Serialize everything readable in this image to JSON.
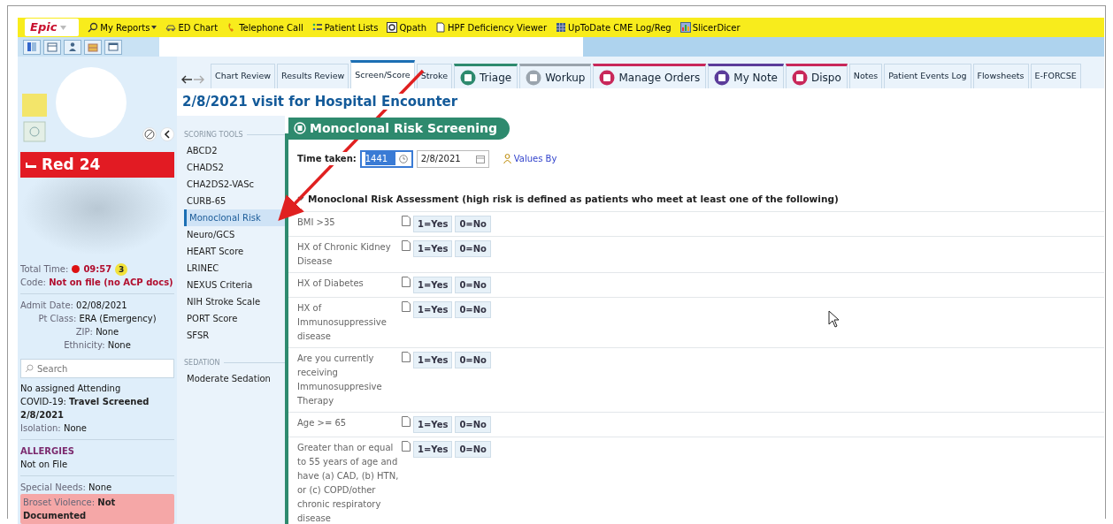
{
  "toolbar": {
    "menu": "Epic",
    "items": [
      {
        "label": "My Reports",
        "dropdown": true
      },
      {
        "label": "ED Chart",
        "dropdown": false
      },
      {
        "label": "Telephone Call",
        "dropdown": false
      },
      {
        "label": "Patient Lists",
        "dropdown": false
      },
      {
        "label": "Qpath",
        "dropdown": false
      },
      {
        "label": "HPF Deficiency Viewer",
        "dropdown": false
      },
      {
        "label": "UpToDate CME Log/Reg",
        "dropdown": false
      },
      {
        "label": "SlicerDicer",
        "dropdown": false
      }
    ]
  },
  "sidebar": {
    "unit": "Red 24",
    "total_time": {
      "label": "Total Time:",
      "value": "09:57",
      "badge": "3"
    },
    "code": {
      "label": "Code:",
      "value": "Not on file (no ACP docs)"
    },
    "details": [
      {
        "label": "Admit Date:",
        "value": "02/08/2021"
      },
      {
        "label": "Pt Class:",
        "value": "ERA (Emergency)"
      },
      {
        "label": "ZIP:",
        "value": "None"
      },
      {
        "label": "Ethnicity:",
        "value": "None"
      }
    ],
    "search": {
      "placeholder": "Search"
    },
    "attending": "No assigned Attending",
    "covid": {
      "label": "COVID-19:",
      "value": "Travel Screened 2/8/2021"
    },
    "isolation": {
      "label": "Isolation:",
      "value": "None"
    },
    "allergies": {
      "heading": "ALLERGIES",
      "value": "Not on File"
    },
    "special_needs": {
      "label": "Special Needs:",
      "value": "None"
    },
    "broset": {
      "label": "Broset Violence:",
      "value": "Not Documented"
    }
  },
  "tabs": [
    {
      "label": "Chart Review",
      "selected": false,
      "kind": "plain"
    },
    {
      "label": "Results Review",
      "selected": false,
      "kind": "plain"
    },
    {
      "label": "Screen/Score",
      "selected": true,
      "kind": "plain"
    },
    {
      "label": "Stroke",
      "selected": false,
      "kind": "plain"
    },
    {
      "label": "Triage",
      "selected": false,
      "kind": "activity",
      "color": "#2e8a6e"
    },
    {
      "label": "Workup",
      "selected": false,
      "kind": "activity",
      "color": "#9aa4ad"
    },
    {
      "label": "Manage Orders",
      "selected": false,
      "kind": "activity",
      "color": "#c8285a"
    },
    {
      "label": "My Note",
      "selected": false,
      "kind": "activity",
      "color": "#5b3c9a"
    },
    {
      "label": "Dispo",
      "selected": false,
      "kind": "activity",
      "color": "#c8285a"
    },
    {
      "label": "Notes",
      "selected": false,
      "kind": "plain"
    },
    {
      "label": "Patient Events Log",
      "selected": false,
      "kind": "plain"
    },
    {
      "label": "Flowsheets",
      "selected": false,
      "kind": "plain"
    },
    {
      "label": "E-FORCSE",
      "selected": false,
      "kind": "plain"
    }
  ],
  "encounter_title": "2/8/2021 visit for Hospital Encounter",
  "scoring_tools": {
    "heading": "SCORING TOOLS",
    "items": [
      {
        "label": "ABCD2",
        "selected": false
      },
      {
        "label": "CHADS2",
        "selected": false
      },
      {
        "label": "CHA2DS2-VASc",
        "selected": false
      },
      {
        "label": "CURB-65",
        "selected": false
      },
      {
        "label": "Monoclonal Risk",
        "selected": true
      },
      {
        "label": "Neuro/GCS",
        "selected": false
      },
      {
        "label": "HEART Score",
        "selected": false
      },
      {
        "label": "LRINEC",
        "selected": false
      },
      {
        "label": "NEXUS Criteria",
        "selected": false
      },
      {
        "label": "NIH Stroke Scale",
        "selected": false
      },
      {
        "label": "PORT Score",
        "selected": false
      },
      {
        "label": "SFSR",
        "selected": false
      }
    ],
    "sedation_heading": "SEDATION",
    "sedation_items": [
      {
        "label": "Moderate Sedation",
        "selected": false
      }
    ]
  },
  "form": {
    "title": "Monoclonal Risk Screening",
    "time_label": "Time taken:",
    "time_value": "1441",
    "date_value": "2/8/2021",
    "values_by": "Values By",
    "section": {
      "heading": "Monoclonal Risk Assessment (high risk is defined as patients who meet at least one of the following)",
      "expanded": true
    },
    "rows": [
      {
        "label": "BMI >35",
        "options": [
          "1=Yes",
          "0=No"
        ]
      },
      {
        "label": "HX of Chronic Kidney Disease",
        "options": [
          "1=Yes",
          "0=No"
        ]
      },
      {
        "label": "HX of Diabetes",
        "options": [
          "1=Yes",
          "0=No"
        ]
      },
      {
        "label": "HX of Immunosuppressive disease",
        "options": [
          "1=Yes",
          "0=No"
        ]
      },
      {
        "label": "Are you currently receiving Immunosuppresive Therapy",
        "options": [
          "1=Yes",
          "0=No"
        ]
      },
      {
        "label": "Age >= 65",
        "options": [
          "1=Yes",
          "0=No"
        ]
      },
      {
        "label": "Greater than or equal to 55 years of age and have (a) CAD, (b) HTN, or (c) COPD/other chronic respiratory disease",
        "options": [
          "1=Yes",
          "0=No"
        ]
      }
    ]
  }
}
